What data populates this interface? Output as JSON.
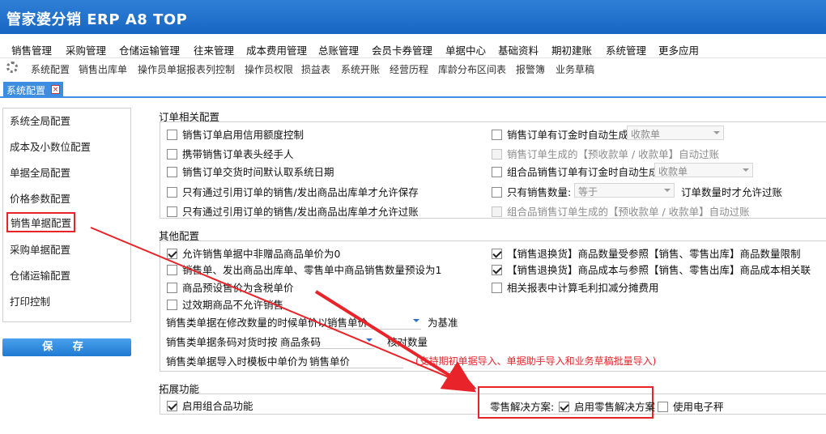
{
  "app": {
    "title": "管家婆分销 ERP A8 TOP"
  },
  "menu": [
    "销售管理",
    "采购管理",
    "仓储运输管理",
    "往来管理",
    "成本费用管理",
    "总账管理",
    "会员卡券管理",
    "单据中心",
    "基础资料",
    "期初建账",
    "系统管理",
    "更多应用"
  ],
  "toolbar": [
    "系统配置",
    "销售出库单",
    "操作员单据报表列控制",
    "操作员权限",
    "损益表",
    "系统开账",
    "经营历程",
    "库龄分布区间表",
    "报警簿",
    "业务草稿"
  ],
  "tab": {
    "label": "系统配置",
    "close": "×"
  },
  "sidebar": {
    "items": [
      "系统全局配置",
      "成本及小数位配置",
      "单据全局配置",
      "价格参数配置",
      "销售单据配置",
      "采购单据配置",
      "仓储运输配置",
      "打印控制"
    ],
    "active_index": 4
  },
  "save_label": "保 存",
  "order_section": {
    "title": "订单相关配置",
    "left": [
      {
        "label": "销售订单启用信用额度控制",
        "checked": false
      },
      {
        "label": "携带销售订单表头经手人",
        "checked": false
      },
      {
        "label": "销售订单交货时间默认取系统日期",
        "checked": false
      },
      {
        "label": "只有通过引用订单的销售/发出商品出库单才允许保存",
        "checked": false
      },
      {
        "label": "只有通过引用订单的销售/发出商品出库单才允许过账",
        "checked": false
      }
    ],
    "right": {
      "r1_label": "销售订单有订金时自动生成",
      "r1_combo": "收款单",
      "r2_label": "销售订单生成的【预收款单 / 收款单】自动过账",
      "r3_label": "组合品销售订单有订金时自动生成",
      "r3_combo": "收款单",
      "r4_label": "只有销售数量:",
      "r4_combo": "等于",
      "r4_suffix": "订单数量时才允许过账",
      "r5_label": "组合品销售订单生成的【预收款单 / 收款单】自动过账"
    }
  },
  "other_section": {
    "title": "其他配置",
    "left": [
      {
        "label": "允许销售单据中非赠品商品单价为0",
        "checked": true
      },
      {
        "label": "销售单、发出商品出库单、零售单中商品销售数量预设为1",
        "checked": false
      },
      {
        "label": "商品预设售价为含税单价",
        "checked": false
      },
      {
        "label": "过效期商品不允许销售",
        "checked": false
      }
    ],
    "right": [
      {
        "label": "【销售退换货】商品数量受参照【销售、零售出库】商品数量限制",
        "checked": true
      },
      {
        "label": "【销售退换货】商品成本与参照【销售、零售出库】商品成本相关联",
        "checked": true
      },
      {
        "label": "相关报表中计算毛利扣减分摊费用",
        "checked": false
      }
    ],
    "price_mod": {
      "label": "销售类单据在修改数量的时候单价以",
      "value": "销售单价",
      "suffix": "为基准"
    },
    "barcode": {
      "label": "销售类单据条码对货时按",
      "value": "商品条码",
      "suffix": "核对数量"
    },
    "import": {
      "label": "销售类单据导入时模板中单价为",
      "value": "销售单价",
      "note": "(支持期初单据导入、单据助手导入和业务草稿批量导入)"
    }
  },
  "ext_section": {
    "title": "拓展功能",
    "combo_label": "启用组合品功能",
    "retail_label": "零售解决方案:",
    "retail_enable": "启用零售解决方案",
    "scale": "使用电子秤"
  },
  "colors": {
    "title_bar": "#1766c2",
    "highlight": "#e8242a",
    "tab": "#3d8ee0"
  }
}
